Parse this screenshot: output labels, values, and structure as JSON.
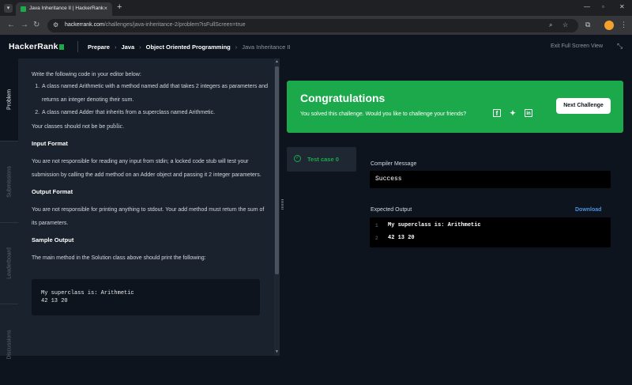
{
  "browser": {
    "tab_title": "Java Inheritance II | HackerRank",
    "url_host": "hackerrank.com",
    "url_path": "/challenges/java-inheritance-2/problem?isFullScreen=true"
  },
  "header": {
    "logo": "HackerRank",
    "breadcrumb": [
      "Prepare",
      "Java",
      "Object Oriented Programming"
    ],
    "current": "Java Inheritance II",
    "exit_fullscreen": "Exit Full Screen View"
  },
  "vtabs": [
    "Problem",
    "Submissions",
    "Leaderboard",
    "Discussions"
  ],
  "problem": {
    "intro": "Write the following code in your editor below:",
    "list": [
      "A class named Arithmetic with a method named add that takes 2 integers as parameters and returns an integer denoting their sum.",
      "A class named Adder that inherits from a superclass named Arithmetic."
    ],
    "note_prefix": "Your classes should not be be ",
    "note_code": "public",
    "note_suffix": ".",
    "input_heading": "Input Format",
    "input_text": "You are not responsible for reading any input from stdin; a locked code stub will test your submission by calling the add method on an Adder object and passing it 2 integer parameters.",
    "output_heading": "Output Format",
    "output_text": "You are not responsible for printing anything to stdout. Your add method must return the sum of its parameters.",
    "sample_heading": "Sample Output",
    "sample_text": "The main method in the Solution class above should print the following:",
    "sample_output": "My superclass is: Arithmetic\n42 13 20"
  },
  "result": {
    "title": "Congratulations",
    "subtitle": "You solved this challenge. Would you like to challenge your friends?",
    "next_button": "Next Challenge",
    "testcase": "Test case 0",
    "compiler_label": "Compiler Message",
    "compiler_message": "Success",
    "expected_label": "Expected Output",
    "download": "Download",
    "expected_lines": [
      {
        "n": "1",
        "text": "My superclass is: Arithmetic"
      },
      {
        "n": "2",
        "text": "42 13 20"
      }
    ]
  },
  "colors": {
    "accent_green": "#1ba94c",
    "background": "#0e141e",
    "panel": "#1a222d",
    "link_blue": "#4a90e2"
  }
}
